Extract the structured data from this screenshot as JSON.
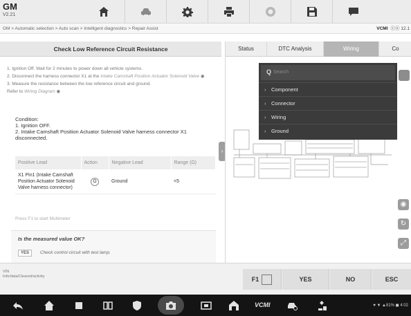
{
  "app": {
    "brand": "GM",
    "version": "V2.21"
  },
  "breadcrumb": "GM > Automatic selection > Auto scan > Intelligent diagnostics > Repair Assist",
  "vin": {
    "label": "VCMI",
    "value": "ⓒⓔ 12.1"
  },
  "left": {
    "title": "Check Low Reference Circuit Resistance",
    "steps": [
      "1. Ignition Off. Wait for 2 minutes to power down all vehicle systems.",
      "2. Disconnect the harness connector X1 at the ",
      "Intake Camshaft Position Actuator Solenoid Valve",
      "3. Measure the resistance between the low reference circuit and ground.",
      "Refer to ",
      "Wiring Diagram"
    ],
    "condition": {
      "label": "Condition:",
      "line1": "1. Ignition OFF.",
      "line2": "2. Intake Camshaft Position Actuator Solenoid Valve harness connector X1 disconnected."
    },
    "table": {
      "headers": [
        "Positive Lead",
        "Action",
        "Negative Lead",
        "Range (Ω)"
      ],
      "row": {
        "positive": "X1 Pin1 (Intake Camshaft Position Actuator Solenoid Valve harness connector)",
        "action": "Ω",
        "negative": "Ground",
        "range": "<5"
      }
    },
    "press_hint": "Press F1 to start Multimeter",
    "question": "Is the measured value OK?",
    "yes_tag": "YES",
    "yes_answer": "Check control circuit with test lamp."
  },
  "right": {
    "tabs": [
      "Status",
      "DTC Analysis",
      "Wiring",
      "Co"
    ],
    "search_placeholder": "Search",
    "menu_items": [
      "Component",
      "Connector",
      "Wiring",
      "Ground"
    ]
  },
  "info_text": [
    "VIN",
    "Info/data/Cleared/activity"
  ],
  "buttons": {
    "f1": "F1",
    "yes": "YES",
    "no": "NO",
    "esc": "ESC"
  },
  "nav": {
    "vcmi": "VCMI",
    "status": "♥ ▼ ▲81% ◼ 4:02"
  },
  "colors": {
    "menu_bg": "#3b3b3b",
    "active_tab": "#b5b5b5",
    "nav_bg": "#141414"
  }
}
